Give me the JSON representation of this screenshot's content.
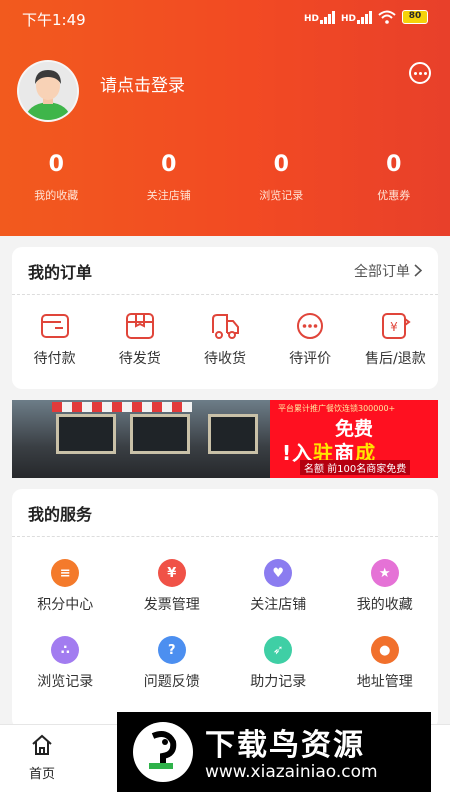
{
  "status_bar": {
    "time": "下午1:49",
    "battery": "80"
  },
  "profile": {
    "login_prompt": "请点击登录"
  },
  "stats": [
    {
      "value": "0",
      "label": "我的收藏"
    },
    {
      "value": "0",
      "label": "关注店铺"
    },
    {
      "value": "0",
      "label": "浏览记录"
    },
    {
      "value": "0",
      "label": "优惠券"
    }
  ],
  "orders": {
    "title": "我的订单",
    "all_label": "全部订单",
    "items": [
      {
        "label": "待付款",
        "icon": "wallet-icon"
      },
      {
        "label": "待发货",
        "icon": "package-icon"
      },
      {
        "label": "待收货",
        "icon": "truck-icon"
      },
      {
        "label": "待评价",
        "icon": "comment-icon"
      },
      {
        "label": "售后/退款",
        "icon": "refund-icon"
      }
    ]
  },
  "banner": {
    "top_text": "平台累计推广餐饮连锁300000+",
    "free": "免费",
    "main_a": "入",
    "main_b": "驻",
    "main_c": "商",
    "main_d": "成",
    "badge": "名额",
    "bottom_text": "前100名商家免费"
  },
  "services": {
    "title": "我的服务",
    "items": [
      {
        "label": "积分中心",
        "icon": "coins-icon",
        "color": "#f47a2b"
      },
      {
        "label": "发票管理",
        "icon": "invoice-icon",
        "color": "#f05247"
      },
      {
        "label": "关注店铺",
        "icon": "heart-icon",
        "color": "#8b7cf0"
      },
      {
        "label": "我的收藏",
        "icon": "star-icon",
        "color": "#e572d6"
      },
      {
        "label": "浏览记录",
        "icon": "footprint-icon",
        "color": "#a27cf0"
      },
      {
        "label": "问题反馈",
        "icon": "question-icon",
        "color": "#4c8ff0"
      },
      {
        "label": "助力记录",
        "icon": "rocket-icon",
        "color": "#3fcfa5"
      },
      {
        "label": "地址管理",
        "icon": "location-icon",
        "color": "#f1702c"
      }
    ]
  },
  "tabbar": {
    "home": "首页"
  },
  "watermark": {
    "title": "下载鸟资源",
    "url": "www.xiazainiao.com"
  }
}
